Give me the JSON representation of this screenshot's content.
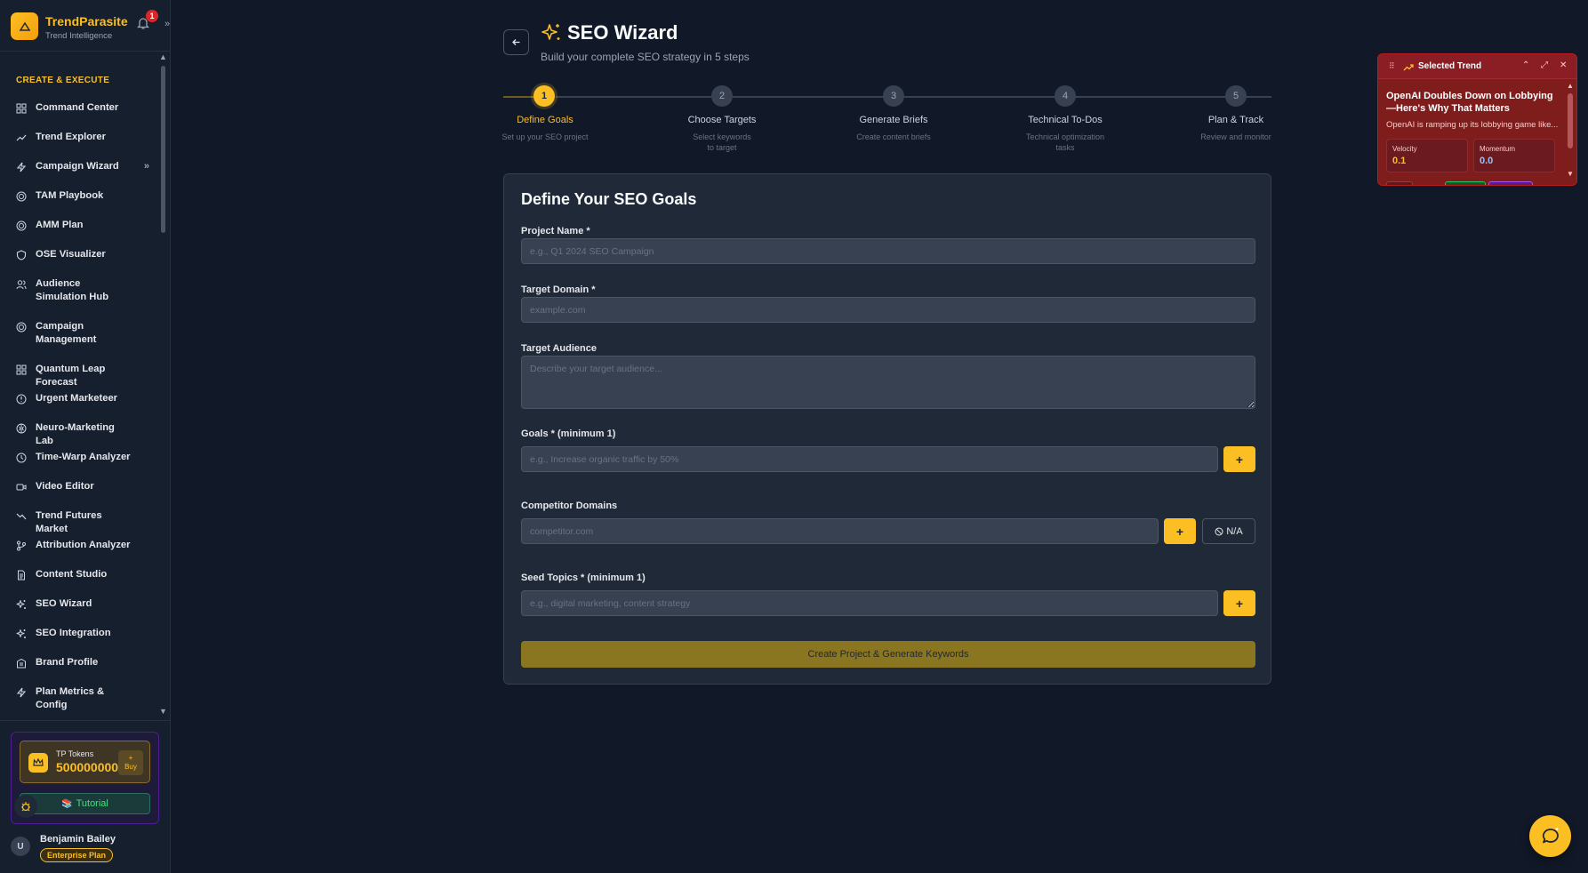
{
  "brand": {
    "name": "TrendParasite",
    "subtitle": "Trend Intelligence",
    "notifications": "1"
  },
  "sidebar": {
    "section": "CREATE & EXECUTE",
    "items": [
      {
        "label": "Command Center",
        "icon": "grid-icon"
      },
      {
        "label": "Trend Explorer",
        "icon": "trending-up-icon"
      },
      {
        "label": "Campaign Wizard",
        "icon": "bolt-icon",
        "arrow": "»"
      },
      {
        "label": "TAM Playbook",
        "icon": "target-icon"
      },
      {
        "label": "AMM Plan",
        "icon": "target-icon"
      },
      {
        "label": "OSE Visualizer",
        "icon": "shield-icon"
      },
      {
        "label": "Audience Simulation Hub",
        "icon": "users-icon"
      },
      {
        "label": "Campaign Management",
        "icon": "target-icon"
      },
      {
        "label": "Quantum Leap Forecast",
        "icon": "grid-icon"
      },
      {
        "label": "Urgent Marketeer",
        "icon": "alert-icon"
      },
      {
        "label": "Neuro-Marketing Lab",
        "icon": "brain-icon"
      },
      {
        "label": "Time-Warp Analyzer",
        "icon": "clock-icon"
      },
      {
        "label": "Video Editor",
        "icon": "video-icon"
      },
      {
        "label": "Trend Futures Market",
        "icon": "trending-down-icon"
      },
      {
        "label": "Attribution Analyzer",
        "icon": "branch-icon"
      },
      {
        "label": "Content Studio",
        "icon": "file-icon"
      },
      {
        "label": "SEO Wizard",
        "icon": "sparkle-icon"
      },
      {
        "label": "SEO Integration",
        "icon": "sparkle-icon"
      },
      {
        "label": "Brand Profile",
        "icon": "building-icon"
      },
      {
        "label": "Plan Metrics & Config",
        "icon": "bolt-icon"
      }
    ]
  },
  "tokens": {
    "label": "TP Tokens",
    "value": "500000000",
    "buy_plus": "+",
    "buy_label": "Buy"
  },
  "tutorial": {
    "emoji": "📚",
    "label": "Tutorial"
  },
  "user": {
    "initial": "U",
    "name": "Benjamin Bailey",
    "plan": "Enterprise Plan"
  },
  "page": {
    "title": "SEO Wizard",
    "subtitle": "Build your complete SEO strategy in 5 steps"
  },
  "steps": [
    {
      "num": "1",
      "label": "Define Goals",
      "desc": "Set up your SEO project"
    },
    {
      "num": "2",
      "label": "Choose Targets",
      "desc": "Select keywords to target"
    },
    {
      "num": "3",
      "label": "Generate Briefs",
      "desc": "Create content briefs"
    },
    {
      "num": "4",
      "label": "Technical To-Dos",
      "desc": "Technical optimization tasks"
    },
    {
      "num": "5",
      "label": "Plan & Track",
      "desc": "Review and monitor"
    }
  ],
  "form": {
    "title": "Define Your SEO Goals",
    "project_label": "Project Name *",
    "project_placeholder": "e.g., Q1 2024 SEO Campaign",
    "domain_label": "Target Domain *",
    "domain_placeholder": "example.com",
    "audience_label": "Target Audience",
    "audience_placeholder": "Describe your target audience...",
    "goals_label": "Goals * (minimum 1)",
    "goals_placeholder": "e.g., Increase organic traffic by 50%",
    "competitors_label": "Competitor Domains",
    "competitors_placeholder": "competitor.com",
    "na_label": "N/A",
    "topics_label": "Seed Topics * (minimum 1)",
    "topics_placeholder": "e.g., digital marketing, content strategy",
    "plus": "+",
    "submit_label": "Create Project & Generate Keywords"
  },
  "trend_widget": {
    "title": "Selected Trend",
    "headline": "OpenAI Doubles Down on Lobbying—Here's Why That Matters",
    "description": "OpenAI is ramping up its lobbying game like...",
    "velocity_label": "Velocity",
    "velocity_value": "0.1",
    "momentum_label": "Momentum",
    "momentum_value": "0.0"
  },
  "colors": {
    "accent": "#fbbf24",
    "bg": "#111827",
    "card": "#1f2937",
    "widget": "#7f1d1d"
  }
}
